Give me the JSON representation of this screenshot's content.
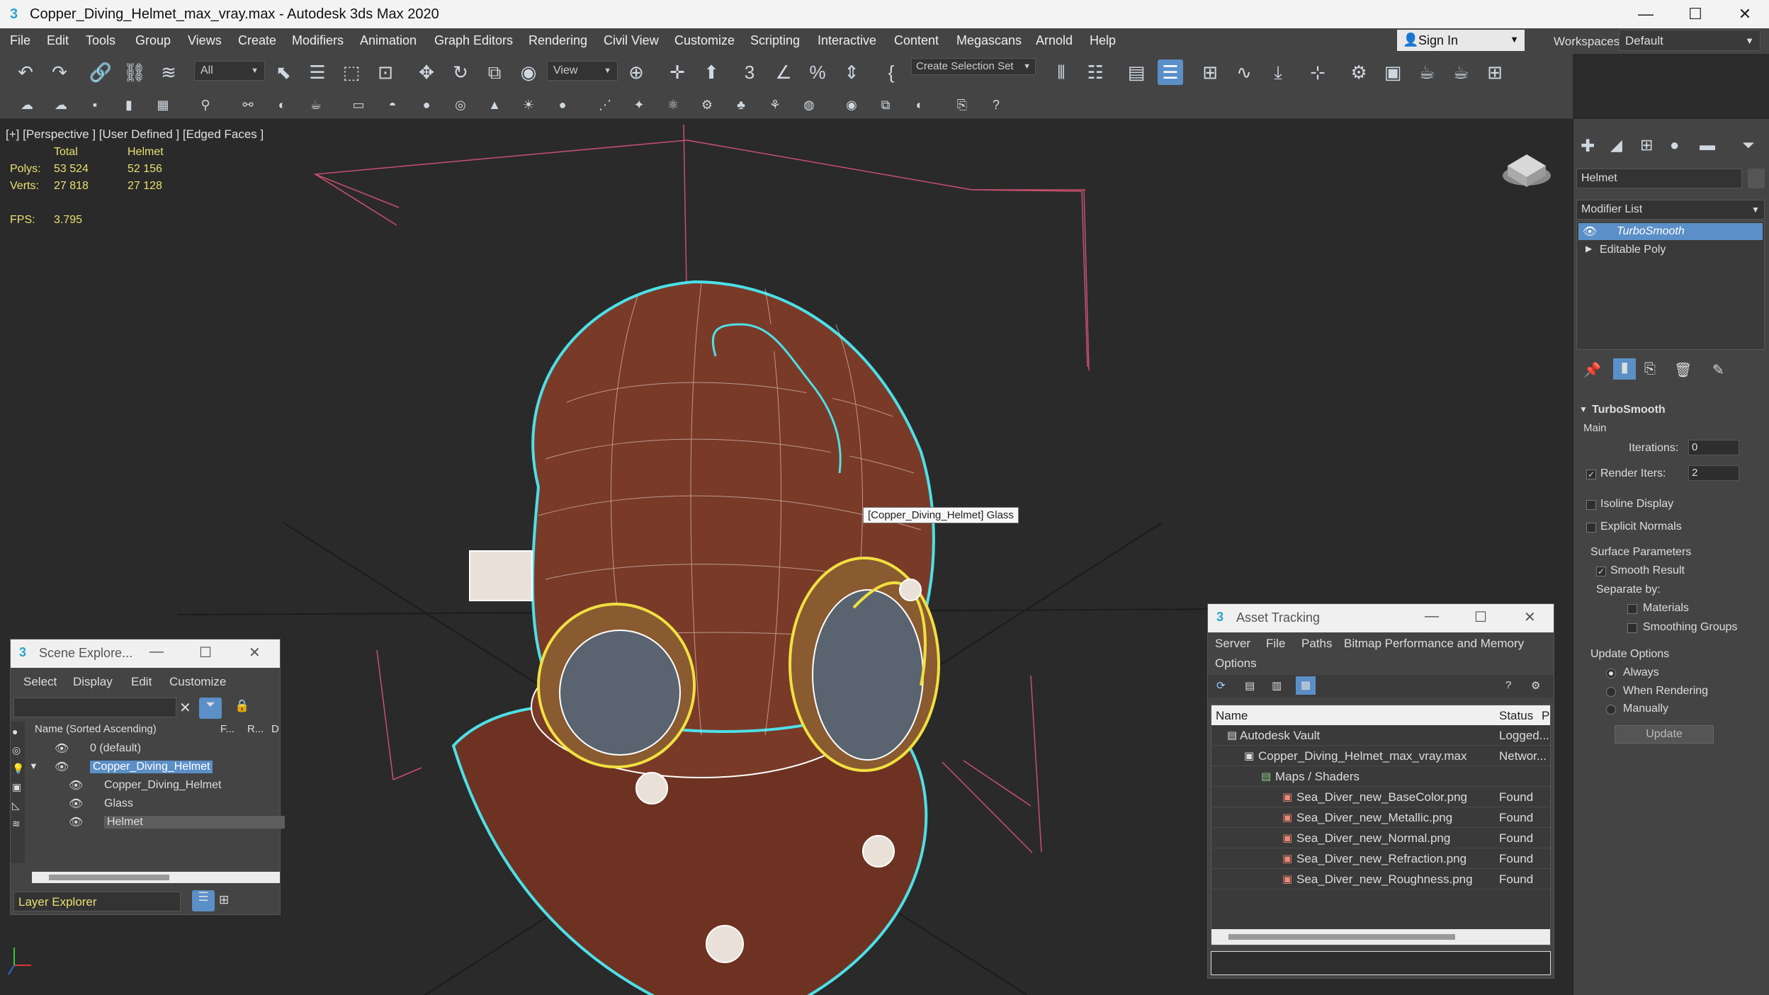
{
  "window": {
    "title": "Copper_Diving_Helmet_max_vray.max - Autodesk 3ds Max 2020",
    "app_icon": "3",
    "minimize": "—",
    "maximize": "☐",
    "close": "✕"
  },
  "menu": {
    "items": [
      "File",
      "Edit",
      "Tools",
      "Group",
      "Views",
      "Create",
      "Modifiers",
      "Animation",
      "Graph Editors",
      "Rendering",
      "Civil View",
      "Customize",
      "Scripting",
      "Interactive",
      "Content",
      "Megascans",
      "Arnold",
      "Help"
    ],
    "signin": "Sign In",
    "workspaces_label": "Workspaces:",
    "workspace_value": "Default"
  },
  "toolbar": {
    "filter_value": "All",
    "refcoord_value": "View",
    "selection_set_value": "Create Selection Set"
  },
  "viewport": {
    "label": "[+] [Perspective ] [User Defined ] [Edged Faces ]",
    "stats_header_total": "Total",
    "stats_header_object": "Helmet",
    "polys_label": "Polys:",
    "polys_total": "53 524",
    "polys_object": "52 156",
    "verts_label": "Verts:",
    "verts_total": "27 818",
    "verts_object": "27 128",
    "fps_label": "FPS:",
    "fps_value": "3.795",
    "tooltip": "[Copper_Diving_Helmet] Glass",
    "colors": {
      "copper": "#7a3a28",
      "wire": "#ffffff",
      "selection": "#4ce0e8",
      "highlight": "#f0e040"
    }
  },
  "scene_explorer": {
    "title": "Scene Explore...",
    "menus": [
      "Select",
      "Display",
      "Edit",
      "Customize"
    ],
    "header_name": "Name (Sorted Ascending)",
    "header_f": "F...",
    "header_r": "R...",
    "header_d": "D",
    "rows": [
      {
        "label": "0 (default)"
      },
      {
        "label": "Copper_Diving_Helmet"
      },
      {
        "label": "Copper_Diving_Helmet"
      },
      {
        "label": "Glass"
      },
      {
        "label": "Helmet"
      }
    ],
    "footer": "Layer Explorer"
  },
  "asset_tracking": {
    "title": "Asset Tracking",
    "menus": [
      "Server",
      "File",
      "Paths",
      "Bitmap Performance and Memory",
      "Options"
    ],
    "col_name": "Name",
    "col_status": "Status",
    "col_p": "P",
    "rows": [
      {
        "name": "Autodesk Vault",
        "status": "Logged..."
      },
      {
        "name": "Copper_Diving_Helmet_max_vray.max",
        "status": "Networ..."
      },
      {
        "name": "Maps / Shaders",
        "status": ""
      },
      {
        "name": "Sea_Diver_new_BaseColor.png",
        "status": "Found"
      },
      {
        "name": "Sea_Diver_new_Metallic.png",
        "status": "Found"
      },
      {
        "name": "Sea_Diver_new_Normal.png",
        "status": "Found"
      },
      {
        "name": "Sea_Diver_new_Refraction.png",
        "status": "Found"
      },
      {
        "name": "Sea_Diver_new_Roughness.png",
        "status": "Found"
      }
    ]
  },
  "command_panel": {
    "object_name": "Helmet",
    "modifier_list": "Modifier List",
    "stack": [
      "TurboSmooth",
      "Editable Poly"
    ],
    "rollout_title": "TurboSmooth",
    "main_label": "Main",
    "iterations_label": "Iterations:",
    "iterations_value": "0",
    "render_iters_label": "Render Iters:",
    "render_iters_value": "2",
    "isoline": "Isoline Display",
    "explicit_normals": "Explicit Normals",
    "surface_params": "Surface Parameters",
    "smooth_result": "Smooth Result",
    "separate_by": "Separate by:",
    "materials": "Materials",
    "smoothing_groups": "Smoothing Groups",
    "update_options": "Update Options",
    "always": "Always",
    "when_rendering": "When Rendering",
    "manually": "Manually",
    "update_button": "Update"
  }
}
